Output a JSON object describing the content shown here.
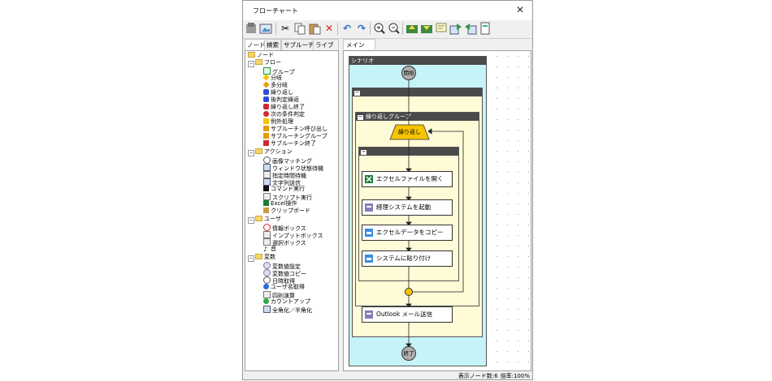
{
  "window": {
    "title": "フローチャート",
    "close_label": "✕"
  },
  "toolbar": {
    "icons": [
      "new-icon",
      "open-icon",
      "cut-icon",
      "copy-icon",
      "paste-icon",
      "delete-icon",
      "undo-icon",
      "redo-icon",
      "zoom-in-icon",
      "zoom-out-icon",
      "export-icon",
      "import-icon",
      "comment-icon",
      "upload-icon",
      "download-icon",
      "page-icon"
    ]
  },
  "left_tabs": [
    "ノード",
    "検索",
    "サブルーチン",
    "ライブラリ"
  ],
  "tree": {
    "root": "ノード",
    "flow": {
      "label": "フロー",
      "items": [
        "グループ",
        "分岐",
        "多分岐",
        "繰り返し",
        "後判定繰返",
        "繰り返し終了",
        "次の条件判定",
        "例外処理",
        "サブルーチン呼び出し",
        "サブルーチングループ",
        "サブルーチン終了"
      ]
    },
    "action": {
      "label": "アクション",
      "items": [
        "画像マッチング",
        "ウィンドウ状態待機",
        "指定時間待機",
        "文字列送信",
        "コマンド実行",
        "スクリプト実行",
        "Excel操作",
        "クリップボード"
      ]
    },
    "user": {
      "label": "ユーザ",
      "items": [
        "情報ボックス",
        "インプットボックス",
        "選択ボックス",
        "音"
      ]
    },
    "variable": {
      "label": "変数",
      "items": [
        "変数値設定",
        "変数値コピー",
        "日時取得",
        "ユーザ名取得",
        "四則演算",
        "カウントアップ",
        "全角化／半角化"
      ]
    }
  },
  "canvas": {
    "tab": "メイン",
    "scenario_label": "シナリオ",
    "start": "開始",
    "end": "終了",
    "loop_group": "繰り返しグループ",
    "loop": "繰り返し",
    "actions": [
      "エクセルファイルを開く",
      "経理システムを起動",
      "エクセルデータをコピー",
      "システムに貼り付け"
    ],
    "outlook": "Outlook メール送信"
  },
  "status": {
    "node_count": "表示ノード数:6",
    "zoom": "倍率:100%"
  },
  "colors": {
    "scenario_bg": "#c6f3f7",
    "group_bg": "#fffbd7",
    "loop_shape": "#f6c400",
    "header": "#4a4a4a"
  }
}
